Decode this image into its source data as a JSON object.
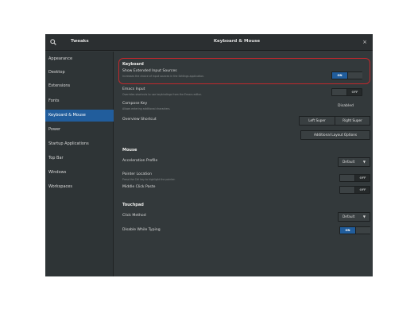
{
  "window": {
    "app_title": "Tweaks",
    "title": "Keyboard & Mouse",
    "close_glyph": "×"
  },
  "sidebar": {
    "items": [
      {
        "label": "Appearance"
      },
      {
        "label": "Desktop"
      },
      {
        "label": "Extensions"
      },
      {
        "label": "Fonts"
      },
      {
        "label": "Keyboard & Mouse",
        "active": true
      },
      {
        "label": "Power"
      },
      {
        "label": "Startup Applications"
      },
      {
        "label": "Top Bar"
      },
      {
        "label": "Windows"
      },
      {
        "label": "Workspaces"
      }
    ]
  },
  "keyboard": {
    "section_title": "Keyboard",
    "extended_sources": {
      "label": "Show Extended Input Sources",
      "description": "Increases the choice of input sources in the Settings application.",
      "state": "ON"
    },
    "emacs_input": {
      "label": "Emacs Input",
      "description": "Overrides shortcuts to use keybindings from the Emacs editor.",
      "state": "OFF"
    },
    "compose_key": {
      "label": "Compose Key",
      "description": "Allows entering additional characters.",
      "value": "Disabled"
    },
    "overview_shortcut": {
      "label": "Overview Shortcut",
      "left_button": "Left Super",
      "right_button": "Right Super"
    },
    "additional_layout_options": "Additional Layout Options"
  },
  "mouse": {
    "section_title": "Mouse",
    "acceleration_profile": {
      "label": "Acceleration Profile",
      "value": "Default"
    },
    "pointer_location": {
      "label": "Pointer Location",
      "description": "Press the Ctrl key to highlight the pointer.",
      "state": "OFF"
    },
    "middle_click_paste": {
      "label": "Middle Click Paste",
      "state": "OFF"
    }
  },
  "touchpad": {
    "section_title": "Touchpad",
    "click_method": {
      "label": "Click Method",
      "value": "Default"
    },
    "disable_while_typing": {
      "label": "Disable While Typing",
      "state": "ON"
    }
  },
  "colors": {
    "accent": "#215d9c",
    "highlight_ring": "#c0282d"
  }
}
